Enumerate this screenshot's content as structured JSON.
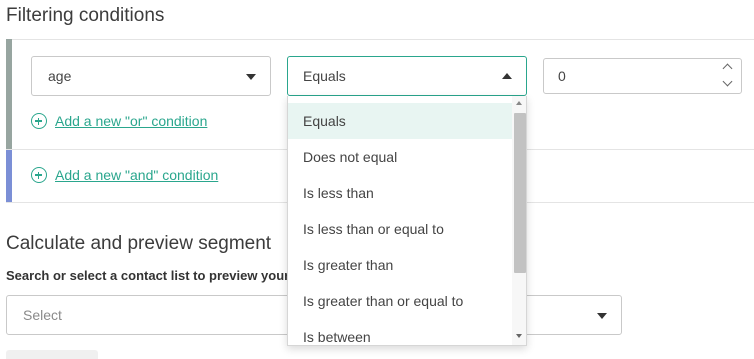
{
  "filtering": {
    "heading": "Filtering conditions",
    "field_value": "age",
    "operator_value": "Equals",
    "number_value": "0",
    "add_or_label": "Add a new \"or\" condition",
    "add_and_label": "Add a new \"and\" condition"
  },
  "operator_options": [
    "Equals",
    "Does not equal",
    "Is less than",
    "Is less than or equal to",
    "Is greater than",
    "Is greater than or equal to",
    "Is between"
  ],
  "calculate": {
    "heading": "Calculate and preview segment",
    "subtitle": "Search or select a contact list to preview your",
    "select_placeholder": "Select"
  },
  "colors": {
    "accent": "#2aa68d",
    "or_bar": "#97a5a0",
    "and_bar": "#7b8fd6"
  },
  "icons": [
    "caret-down-icon",
    "caret-up-icon",
    "plus-circle-icon",
    "spinner-up-icon",
    "spinner-down-icon"
  ]
}
